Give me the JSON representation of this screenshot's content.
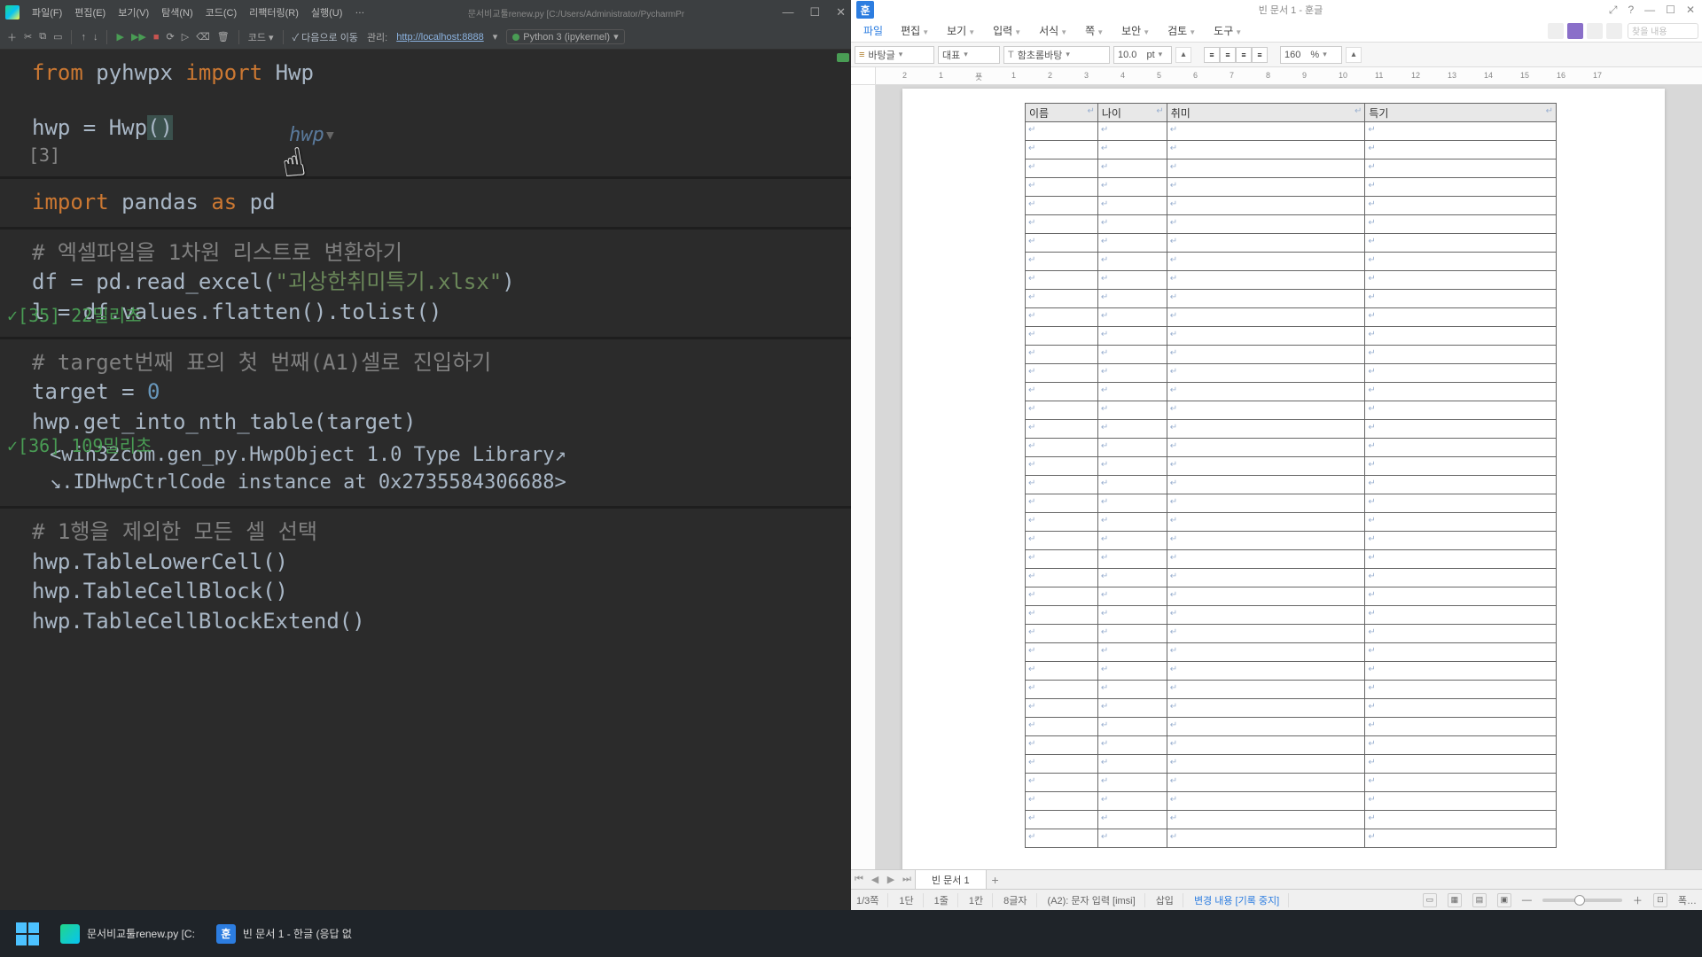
{
  "pycharm": {
    "menu": [
      "파일(F)",
      "편집(E)",
      "보기(V)",
      "탐색(N)",
      "코드(C)",
      "리팩터링(R)",
      "실행(U)",
      "…"
    ],
    "title_path": "문서비교툴renew.py [C:/Users/Administrator/PycharmPr",
    "toolbar": {
      "next_label": "다음으로 이동",
      "manage_label": "관리:",
      "url": "http://localhost:8888",
      "kernel": "Python 3 (ipykernel)",
      "run_config": "코드 ▾"
    },
    "code": {
      "cell1_l1_a": "from ",
      "cell1_l1_b": "pyhwpx ",
      "cell1_l1_c": "import ",
      "cell1_l1_d": "Hwp",
      "cell1_l2_a": "hwp = Hwp",
      "cell1_l2_p1": "(",
      "cell1_l2_p2": ")",
      "cell1_hint": "hwp",
      "cell1_exec": "[3]",
      "cell2_l1_a": "import ",
      "cell2_l1_b": "pandas ",
      "cell2_l1_c": "as ",
      "cell2_l1_d": "pd",
      "cell3_cmt": "# 엑셀파일을 1차원 리스트로 변환하기",
      "cell3_l1_a": "df = pd.read_excel(",
      "cell3_l1_s": "\"괴상한취미특기.xlsx\"",
      "cell3_l1_b": ")",
      "cell3_l2": "l = df.values.flatten().tolist()",
      "cell3_status": "✓[35] 22밀리초",
      "cell4_cmt": "# target번째 표의 첫 번째(A1)셀로 진입하기",
      "cell4_l1_a": "target = ",
      "cell4_l1_n": "0",
      "cell4_l2": "hwp.get_into_nth_table(target)",
      "cell4_status": "✓[36] 109밀리초",
      "cell4_out1": "<win32com.gen_py.HwpObject 1.0 Type Library↗",
      "cell4_out2": "↘.IDHwpCtrlCode instance at 0x2735584306688>",
      "cell5_cmt": "# 1행을 제외한 모든 셀 선택",
      "cell5_l1": "hwp.TableLowerCell()",
      "cell5_l2": "hwp.TableCellBlock()",
      "cell5_l3": "hwp.TableCellBlockExtend()"
    }
  },
  "hwp": {
    "title": "빈 문서 1 - 훈글",
    "menu": [
      "파일",
      "편집",
      "보기",
      "입력",
      "서식",
      "쪽",
      "보안",
      "검토",
      "도구"
    ],
    "fmt": {
      "style": "바탕글",
      "outline": "대표",
      "font": "함초롬바탕",
      "size": "10.0",
      "size_unit": "pt",
      "zoom": "160",
      "zoom_unit": "%"
    },
    "ruler_ticks": [
      "2",
      "1",
      "푯",
      "1",
      "2",
      "3",
      "4",
      "5",
      "6",
      "7",
      "8",
      "9",
      "10",
      "11",
      "12",
      "13",
      "14",
      "15",
      "16",
      "17"
    ],
    "table_headers": [
      "이름",
      "나이",
      "취미",
      "특기"
    ],
    "table_rows": 39,
    "tab": "빈 문서 1",
    "status": {
      "page": "1/3쪽",
      "dan": "1단",
      "line": "1줄",
      "col": "1칸",
      "chars": "8글자",
      "cell": "(A2): 문자 입력  [imsi]",
      "mode": "삽입",
      "track": "변경 내용 [기록 중지]",
      "zoom_menu": "폭…"
    }
  },
  "taskbar": {
    "pycharm": "문서비교툴renew.py [C:",
    "hwp": "빈 문서 1 - 한글 (응답 없"
  }
}
